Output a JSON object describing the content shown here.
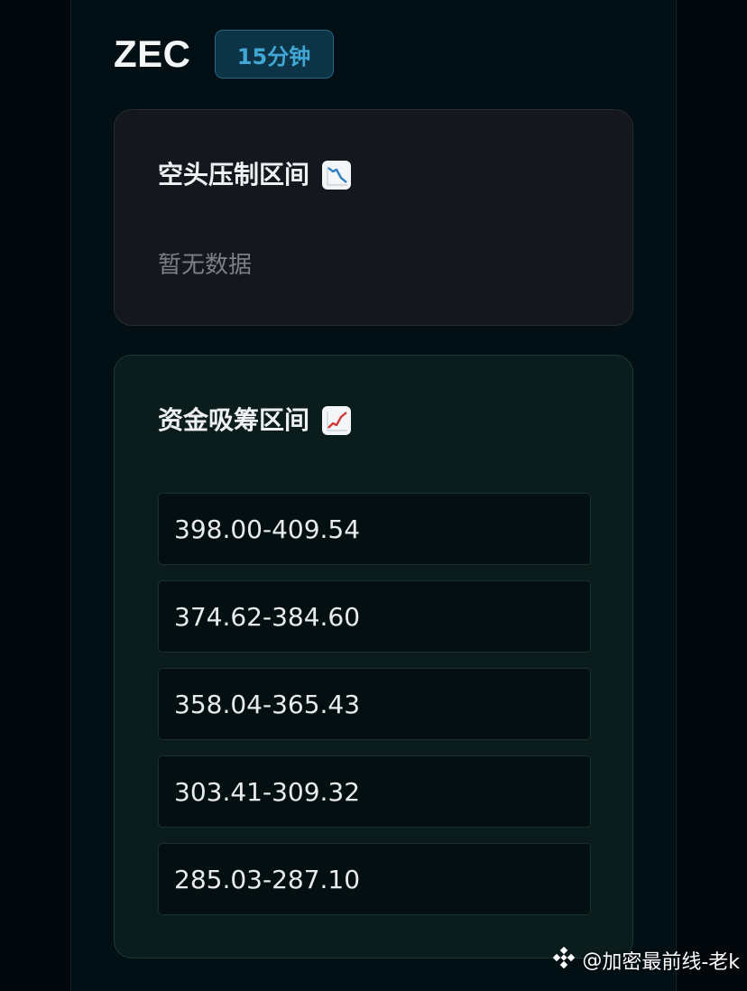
{
  "header": {
    "symbol": "ZEC",
    "timeframe": "15分钟"
  },
  "bear_card": {
    "title": "空头压制区间",
    "icon": "chart-decreasing-icon",
    "empty_text": "暂无数据"
  },
  "bull_card": {
    "title": "资金吸筹区间",
    "icon": "chart-increasing-icon",
    "zones": [
      "398.00-409.54",
      "374.62-384.60",
      "358.04-365.43",
      "303.41-309.32",
      "285.03-287.10"
    ]
  },
  "watermark": {
    "at": "@",
    "text": "加密最前线-老k"
  },
  "colors": {
    "background": "#03080c",
    "panel": "#021015",
    "badge_accent": "#41a8d6",
    "bear_card_bg": "#14171d",
    "bull_card_bg": "#0a1c1b"
  }
}
